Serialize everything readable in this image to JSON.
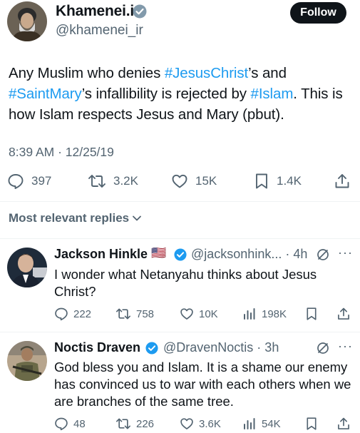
{
  "main_tweet": {
    "name": "Khamenei.ir",
    "handle": "@khamenei_ir",
    "follow_label": "Follow",
    "text": {
      "p1": "Any Muslim who denies ",
      "tag1": "#JesusChrist",
      "p2": "’s and ",
      "tag2": "#SaintMary",
      "p3": "’s infallibility is rejected by ",
      "tag3": "#Islam",
      "p4": ". This is how Islam respects Jesus and Mary (pbut)."
    },
    "timestamp": "8:39 AM · 12/25/19",
    "stats": {
      "replies": "397",
      "reposts": "3.2K",
      "likes": "15K",
      "bookmarks": "1.4K"
    },
    "verified_color": "#1d9bf0"
  },
  "replies_header": "Most relevant replies",
  "replies": [
    {
      "name": "Jackson Hinkle",
      "flag": "🇺🇸",
      "handle": "@jacksonhink... · 4h",
      "text": "I wonder what Netanyahu thinks about Jesus Christ?",
      "stats": {
        "replies": "222",
        "reposts": "758",
        "likes": "10K",
        "views": "198K"
      }
    },
    {
      "name": "Noctis Draven",
      "handle": "@DravenNoctis · 3h",
      "text": "God bless you and Islam. It is a shame our enemy has convinced us to war with each others when we are branches of the same tree.",
      "stats": {
        "replies": "48",
        "reposts": "226",
        "likes": "3.6K",
        "views": "54K"
      }
    }
  ],
  "icons": [
    "reply-icon",
    "repost-icon",
    "like-icon",
    "bookmark-icon",
    "share-icon",
    "views-icon",
    "grok-icon",
    "more-icon",
    "verified-icon",
    "chevron-down-icon"
  ],
  "colors": {
    "accent": "#1d9bf0",
    "text": "#0f1419",
    "muted": "#536471"
  }
}
